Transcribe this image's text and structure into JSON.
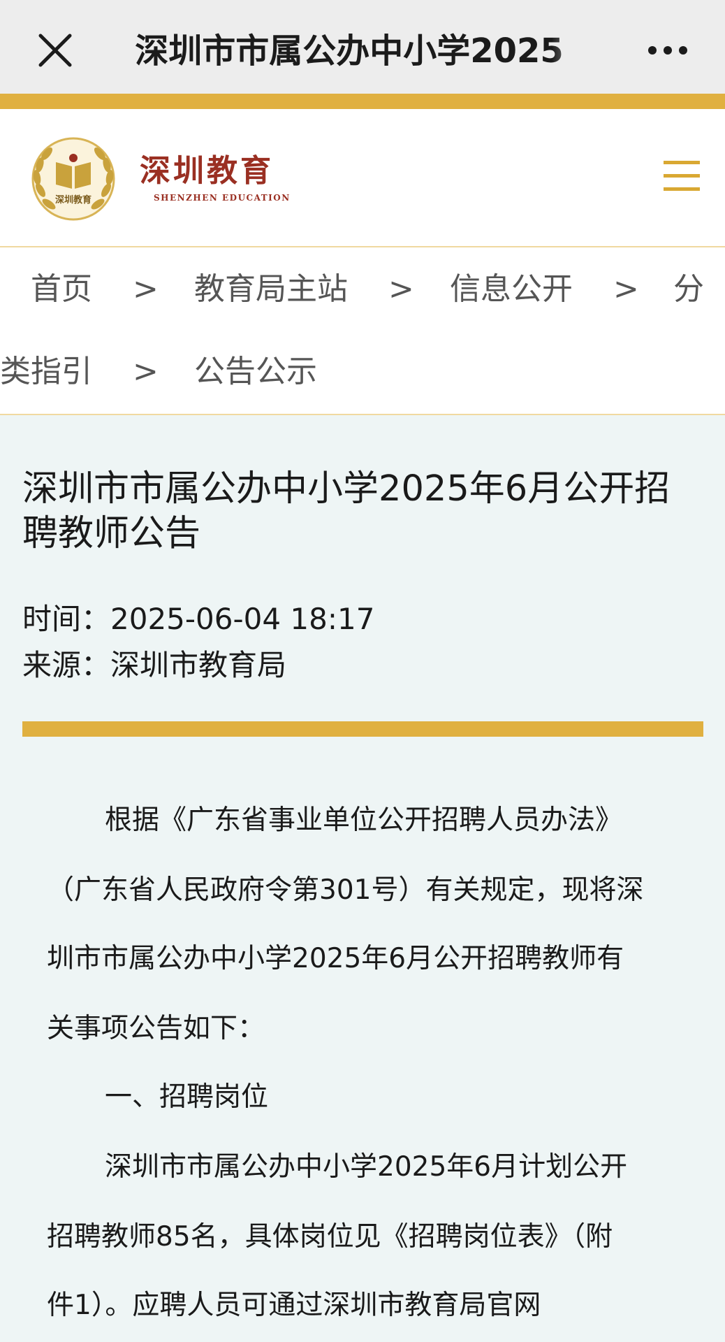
{
  "topbar": {
    "title": "深圳市市属公办中小学2025"
  },
  "site": {
    "logo_badge_text": "深圳教育",
    "logo_cn": "深圳教育",
    "logo_en": "SHENZHEN EDUCATION",
    "accent_color": "#e0b040",
    "brand_color": "#9a2f22"
  },
  "breadcrumb": {
    "items": [
      "首页",
      "教育局主站",
      "信息公开",
      "分",
      "类指引",
      "公告公示"
    ],
    "separator": ">"
  },
  "article": {
    "title_line1": "深圳市市属公办中小学2025年6月公开招",
    "title_line2": "聘教师公告",
    "time": "时间：2025-06-04 18:17",
    "source": "来源：深圳市教育局",
    "lines": [
      "根据《广东省事业单位公开招聘人员办法》",
      "（广东省人民政府令第301号）有关规定，现将深",
      "圳市市属公办中小学2025年6月公开招聘教师有",
      "关事项公告如下：",
      "一、招聘岗位",
      "深圳市市属公办中小学2025年6月计划公开",
      "招聘教师85名，具体岗位见《招聘岗位表》（附",
      "件1）。应聘人员可通过深圳市教育局官网"
    ]
  },
  "icons": {
    "close": "close-icon",
    "more": "more-icon",
    "menu": "hamburger-menu-icon",
    "logo": "shenzhen-education-emblem"
  }
}
